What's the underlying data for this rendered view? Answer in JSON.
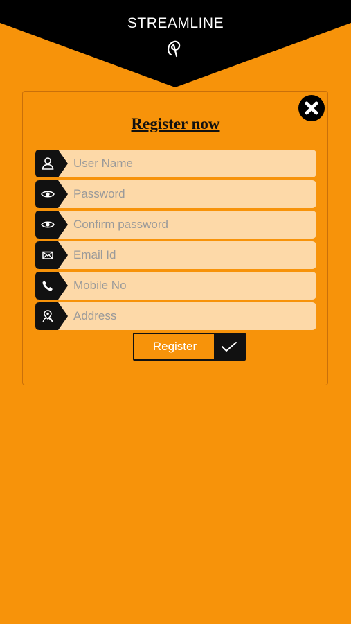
{
  "app": {
    "title": "STREAMLINE",
    "logo_icon": "app-logo-icon"
  },
  "form": {
    "title": "Register now",
    "close_icon": "close-icon",
    "fields": [
      {
        "icon": "user-icon",
        "placeholder": "User Name",
        "value": ""
      },
      {
        "icon": "eye-icon",
        "placeholder": "Password",
        "value": ""
      },
      {
        "icon": "eye-icon",
        "placeholder": "Confirm password",
        "value": ""
      },
      {
        "icon": "mail-icon",
        "placeholder": "Email Id",
        "value": ""
      },
      {
        "icon": "phone-icon",
        "placeholder": "Mobile No",
        "value": ""
      },
      {
        "icon": "address-icon",
        "placeholder": "Address",
        "value": ""
      }
    ],
    "submit": {
      "label": "Register",
      "icon": "checkmark-icon"
    }
  },
  "colors": {
    "background": "#f7930a",
    "header": "#000000",
    "field_background": "#fdd9a8",
    "tag": "#111111",
    "text_light": "#ffffff"
  }
}
